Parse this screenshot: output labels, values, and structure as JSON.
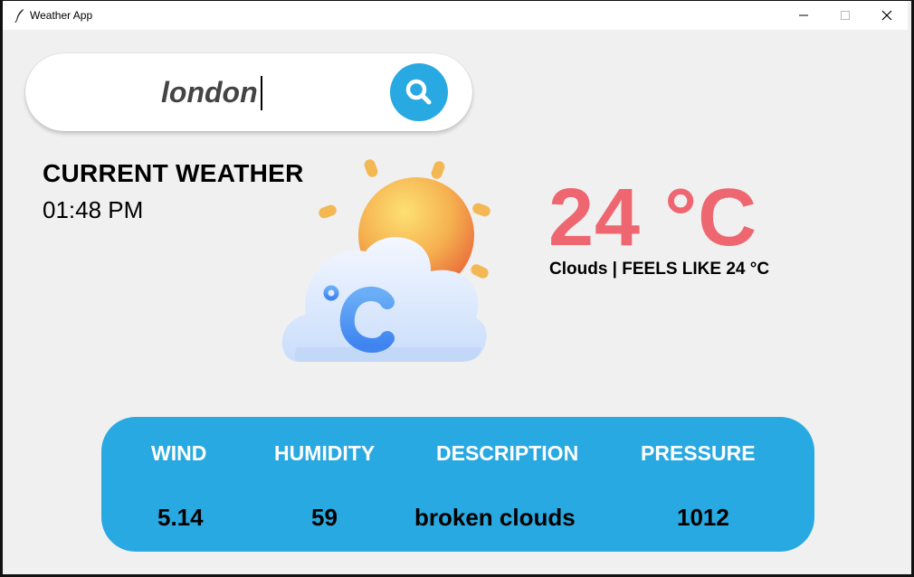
{
  "window": {
    "title": "Weather App",
    "controls": {
      "minimize": "—",
      "maximize": "☐",
      "close": "✕"
    }
  },
  "search": {
    "value": "london",
    "button_icon": "search-icon"
  },
  "current": {
    "label": "CURRENT WEATHER",
    "time": "01:48 PM",
    "illustration_icon": "sun-cloud-celsius-icon"
  },
  "temperature": {
    "value": "24 °C",
    "summary": "Clouds | FEELS LIKE 24 °C"
  },
  "details": {
    "headers": [
      "WIND",
      "HUMIDITY",
      "DESCRIPTION",
      "PRESSURE"
    ],
    "values": [
      "5.14",
      "59",
      "broken clouds",
      "1012"
    ]
  },
  "colors": {
    "accent": "#29a9e1",
    "temperature": "#ee6770",
    "background": "#f0f0f0"
  }
}
